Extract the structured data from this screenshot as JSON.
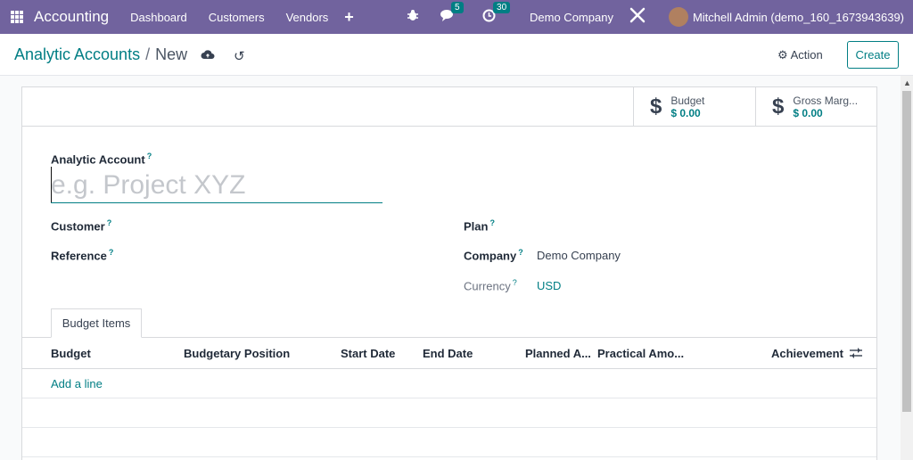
{
  "navbar": {
    "app_title": "Accounting",
    "menu": [
      "Dashboard",
      "Customers",
      "Vendors"
    ],
    "messages_count": "5",
    "activities_count": "30",
    "company": "Demo Company",
    "user": "Mitchell Admin (demo_160_1673943639)"
  },
  "control_panel": {
    "breadcrumb_parent": "Analytic Accounts",
    "breadcrumb_separator": "/",
    "breadcrumb_current": "New",
    "action_label": "Action",
    "create_label": "Create"
  },
  "stat_buttons": [
    {
      "label": "Budget",
      "value": "$ 0.00"
    },
    {
      "label": "Gross Marg...",
      "value": "$ 0.00"
    }
  ],
  "form": {
    "name_label": "Analytic Account",
    "name_placeholder": "e.g. Project XYZ",
    "customer_label": "Customer",
    "reference_label": "Reference",
    "plan_label": "Plan",
    "company_label": "Company",
    "company_value": "Demo Company",
    "currency_label": "Currency",
    "currency_value": "USD",
    "help_mark": "?"
  },
  "tabs": {
    "budget_items": "Budget Items"
  },
  "table": {
    "columns": [
      "Budget",
      "Budgetary Position",
      "Start Date",
      "End Date",
      "Planned A...",
      "Practical Amo...",
      "Achievement"
    ],
    "add_line": "Add a line"
  },
  "colors": {
    "navbar": "#71639e",
    "accent": "#017e84"
  }
}
